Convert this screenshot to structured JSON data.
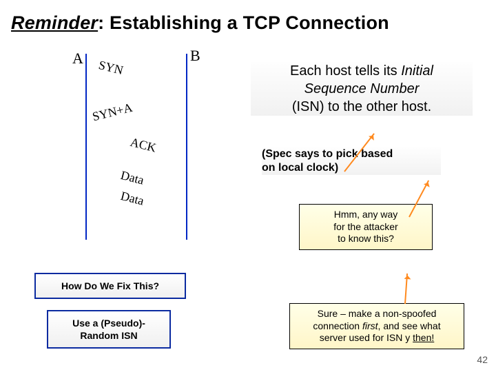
{
  "title": {
    "reminder": "Reminder",
    "rest": ": Establishing a TCP Connection"
  },
  "hosts": {
    "A": "A",
    "B": "B"
  },
  "messages": {
    "syn": "SYN",
    "synack": "SYN+A",
    "ack": "ACK",
    "data1": "Data",
    "data2": "Data"
  },
  "isn": {
    "line1a": "Each host tells its ",
    "line1b": "Initial",
    "line2": "Sequence Number",
    "line3": "(ISN) to the other host."
  },
  "spec_note": {
    "line1": "(Spec says to pick based",
    "line2": "on local clock)"
  },
  "callout1": {
    "line1": "Hmm, any way",
    "line2": "for the attacker",
    "line3": "to know this?"
  },
  "callout2": {
    "line1a": "Sure – make a non-spoofed",
    "line2a": "connection ",
    "first": "first",
    "line2b": ", and see what",
    "line3a": "server used for ISN y ",
    "then": "then!"
  },
  "answers": {
    "q": "How Do We Fix This?",
    "a1": "Use a (Pseudo)-",
    "a2": "Random ISN"
  },
  "page_number": "42"
}
